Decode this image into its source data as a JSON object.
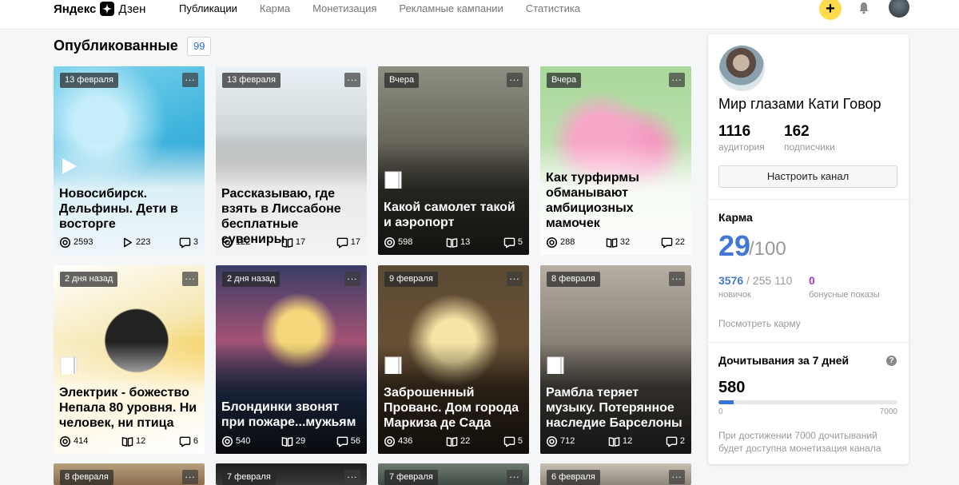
{
  "header": {
    "logo_a": "Яндекс",
    "logo_b": "Дзен",
    "tabs": [
      {
        "label": "Публикации",
        "active": true
      },
      {
        "label": "Карма",
        "active": false
      },
      {
        "label": "Монетизация",
        "active": false
      },
      {
        "label": "Рекламные кампании",
        "active": false
      },
      {
        "label": "Статистика",
        "active": false
      }
    ],
    "plus_label": "+"
  },
  "main": {
    "title": "Опубликованные",
    "count": "99",
    "cards": [
      {
        "date": "13 февраля",
        "kind": "play-icon",
        "title": "Новосибирск. Дельфины. Дети в восторге",
        "theme": "light",
        "stats": [
          {
            "icon": "views-icon",
            "value": "2593"
          },
          {
            "icon": "play-icon",
            "value": "223"
          },
          {
            "icon": "comment-icon",
            "value": "3"
          }
        ]
      },
      {
        "date": "13 февраля",
        "kind": "",
        "title": "Рассказываю, где взять в Лиссабоне бесплатные сувениры",
        "theme": "light",
        "stats": [
          {
            "icon": "views-icon",
            "value": "122"
          },
          {
            "icon": "book-icon",
            "value": "17"
          },
          {
            "icon": "comment-icon",
            "value": "17"
          }
        ]
      },
      {
        "date": "Вчера",
        "kind": "article-icon",
        "title": "Какой самолет такой и аэропорт",
        "theme": "dark",
        "stats": [
          {
            "icon": "views-icon",
            "value": "598"
          },
          {
            "icon": "book-icon",
            "value": "13"
          },
          {
            "icon": "comment-icon",
            "value": "5"
          }
        ]
      },
      {
        "date": "Вчера",
        "kind": "",
        "title": "Как турфирмы обманывают амбициозных мамочек",
        "theme": "light",
        "stats": [
          {
            "icon": "views-icon",
            "value": "288"
          },
          {
            "icon": "book-icon",
            "value": "32"
          },
          {
            "icon": "comment-icon",
            "value": "22"
          }
        ]
      },
      {
        "date": "2 дня назад",
        "kind": "article-icon",
        "title": "Электрик - божество Непала 80 уровня. Ни человек, ни птица",
        "theme": "light",
        "stats": [
          {
            "icon": "views-icon",
            "value": "414"
          },
          {
            "icon": "book-icon",
            "value": "12"
          },
          {
            "icon": "comment-icon",
            "value": "6"
          }
        ]
      },
      {
        "date": "2 дня назад",
        "kind": "",
        "title": "Блондинки звонят при пожаре...мужьям",
        "theme": "dark",
        "stats": [
          {
            "icon": "views-icon",
            "value": "540"
          },
          {
            "icon": "book-icon",
            "value": "29"
          },
          {
            "icon": "comment-icon",
            "value": "56"
          }
        ]
      },
      {
        "date": "9 февраля",
        "kind": "article-icon",
        "title": "Заброшенный Прованс. Дом города Маркиза де Сада",
        "theme": "dark",
        "stats": [
          {
            "icon": "views-icon",
            "value": "436"
          },
          {
            "icon": "book-icon",
            "value": "22"
          },
          {
            "icon": "comment-icon",
            "value": "5"
          }
        ]
      },
      {
        "date": "8 февраля",
        "kind": "article-icon",
        "title": "Рамбла теряет музыку. Потерянное наследие Барселоны",
        "theme": "dark",
        "stats": [
          {
            "icon": "views-icon",
            "value": "712"
          },
          {
            "icon": "book-icon",
            "value": "12"
          },
          {
            "icon": "comment-icon",
            "value": "2"
          }
        ]
      },
      {
        "date": "8 февраля",
        "kind": "",
        "title": "",
        "theme": "dark",
        "stats": []
      },
      {
        "date": "7 февраля",
        "kind": "",
        "title": "",
        "theme": "dark",
        "stats": []
      },
      {
        "date": "7 февраля",
        "kind": "",
        "title": "",
        "theme": "dark",
        "stats": []
      },
      {
        "date": "6 февраля",
        "kind": "",
        "title": "",
        "theme": "dark",
        "stats": []
      }
    ]
  },
  "sidebar": {
    "channel_name": "Мир глазами Кати Говор",
    "audience_value": "1116",
    "audience_label": "аудитория",
    "subscribers_value": "162",
    "subscribers_label": "подписчики",
    "setup_button": "Настроить канал",
    "karma_heading": "Карма",
    "karma_value": "29",
    "karma_max": "/100",
    "newbie_value": "3576",
    "newbie_max": " / 255 110",
    "newbie_label": "новичок",
    "bonus_value": "0",
    "bonus_label": "бонусные показы",
    "karma_link": "Посмотреть карму",
    "reads_heading": "Дочитывания за 7 дней",
    "reads_value": "580",
    "reads_progress": 0.083,
    "reads_min": "0",
    "reads_max": "7000",
    "reads_note": "При достижении 7000 дочитываний будет доступна монетизация канала"
  },
  "colors": {
    "accent_blue": "#4377d6",
    "bonus_purple": "#a63dc9",
    "plus_yellow": "#ffdb4d"
  }
}
